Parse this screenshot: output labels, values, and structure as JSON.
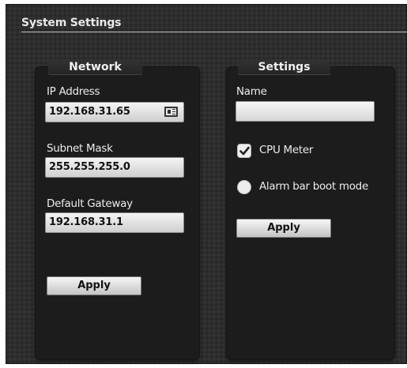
{
  "title": "System Settings",
  "network": {
    "heading": "Network",
    "ip_label": "IP Address",
    "ip_value": "192.168.31.65",
    "subnet_label": "Subnet Mask",
    "subnet_value": "255.255.255.0",
    "gateway_label": "Default Gateway",
    "gateway_value": "192.168.31.1",
    "apply_label": "Apply"
  },
  "settings": {
    "heading": "Settings",
    "name_label": "Name",
    "name_value": "",
    "cpu_meter_label": "CPU Meter",
    "cpu_meter_checked": true,
    "alarm_bar_label": "Alarm bar boot mode",
    "alarm_bar_checked": false,
    "apply_label": "Apply"
  },
  "icons": {
    "ip_field_icon": "id-card-icon",
    "cpu_meter_icon": "checkmark-icon"
  },
  "colors": {
    "panel_bg": "#1c1c1c",
    "frame_bg": "#2e2e2e",
    "text": "#ececec"
  }
}
